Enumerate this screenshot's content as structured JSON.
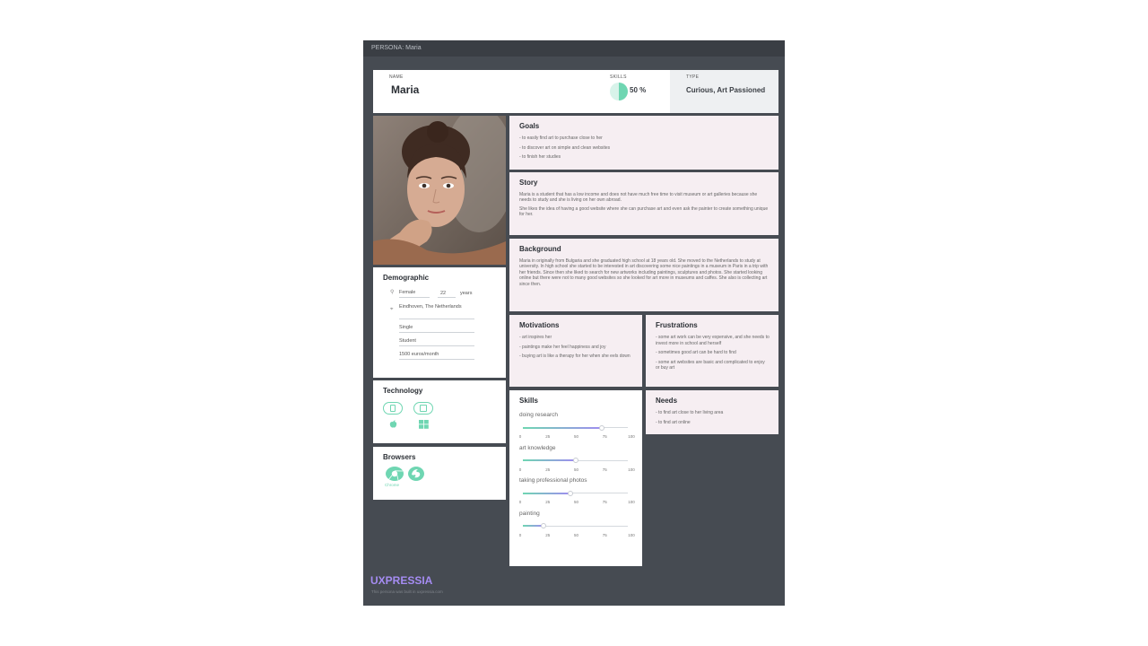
{
  "topbar": {
    "title": "PERSONA: Maria"
  },
  "header": {
    "name_label": "NAME",
    "name": "Maria",
    "skills_label": "SKILLS",
    "skills_value": "50 %",
    "skills_fraction": 0.5,
    "type_label": "TYPE",
    "type_value": "Curious, Art Passioned"
  },
  "goals": {
    "title": "Goals",
    "items": [
      "- to easily find  art to purchase  close to her",
      "- to discover art on simple and clean websites",
      "- to finish her studies"
    ]
  },
  "story": {
    "title": "Story",
    "paragraphs": [
      "Maria is a student that has a low income and does not have much free time to visit museum or art galleries because she needs to study and she is living on her own abroad.",
      "She likes the idea of having a good website where she can purchase art and even ask the painter to create something unique for her."
    ]
  },
  "background": {
    "title": "Background",
    "text": "Maria in originally from Bulgaria and she graduated high school at 18 years old. She moved to the Netherlands to study at university.  In high school she started to be interested in art discovering some nice paintings in a museum in Paris in a trip with her friends. Since then she liked to search for new artworks including paintings, sculptures and photos. She started looking online but there were not to many good websites so she looked for art more in museums and caffes. She also is collecting art since then."
  },
  "demographic": {
    "title": "Demographic",
    "gender": "Female",
    "age": "22",
    "age_unit": "years",
    "location": "Eindhoven, The Netherlands",
    "status": "Single",
    "occupation": "Student",
    "income": "1500 euros/month"
  },
  "technology": {
    "title": "Technology"
  },
  "browsers": {
    "title": "Browsers",
    "chrome_label": "Chrome"
  },
  "motivations": {
    "title": "Motivations",
    "items": [
      "- art inspires her",
      "- paintings make her feel happiness and joy",
      "- buying art is like a therapy for her when she eels down"
    ]
  },
  "frustrations": {
    "title": "Frustrations",
    "items": [
      "- some art work can be very expensive, and she needs to invest more in school and herself",
      "- sometimes good art can be hard to find",
      "- some art websites are basic and complicated to enjoy or buy art"
    ]
  },
  "skills": {
    "title": "Skills",
    "tick_labels": [
      "0",
      "25",
      "50",
      "75",
      "100"
    ],
    "items": [
      {
        "label": "doing research",
        "value": 75
      },
      {
        "label": "art knowledge",
        "value": 50
      },
      {
        "label": "taking professional photos",
        "value": 45
      },
      {
        "label": "painting",
        "value": 20
      }
    ]
  },
  "needs": {
    "title": "Needs",
    "items": [
      "- to find art close to her living area",
      "- to find art online"
    ]
  },
  "footer": {
    "logo": "UXPRESSIA",
    "note": "This persona was built in uxpressia.com"
  },
  "colors": {
    "page": "#464b52",
    "card_pink": "#f6eef2",
    "accent_green": "#6fd6b2",
    "accent_purple": "#a58cf2"
  }
}
